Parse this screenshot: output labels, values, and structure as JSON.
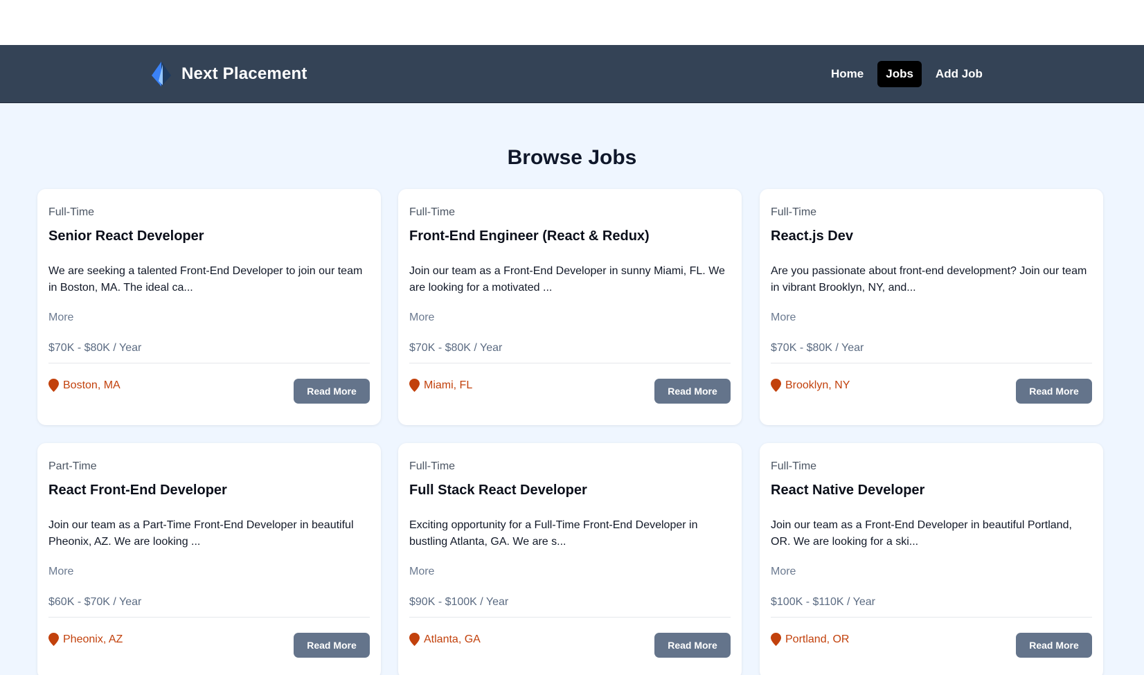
{
  "brand": {
    "name": "Next Placement",
    "logo_icon": "compass-needle-icon"
  },
  "nav": {
    "items": [
      {
        "label": "Home",
        "active": false
      },
      {
        "label": "Jobs",
        "active": true
      },
      {
        "label": "Add Job",
        "active": false
      }
    ]
  },
  "page": {
    "title": "Browse Jobs"
  },
  "colors": {
    "navbar_bg": "#344356",
    "page_bg": "#eff6ff",
    "location_text": "#c2410c",
    "button_bg": "#64748b",
    "active_nav_bg": "#000000"
  },
  "jobs": [
    {
      "type": "Full-Time",
      "title": "Senior React Developer",
      "description": "We are seeking a talented Front-End Developer to join our team in Boston, MA. The ideal ca...",
      "more_label": "More",
      "salary": "$70K - $80K / Year",
      "location": "Boston, MA",
      "button_label": "Read More"
    },
    {
      "type": "Full-Time",
      "title": "Front-End Engineer (React & Redux)",
      "description": "Join our team as a Front-End Developer in sunny Miami, FL. We are looking for a motivated ...",
      "more_label": "More",
      "salary": "$70K - $80K / Year",
      "location": "Miami, FL",
      "button_label": "Read More"
    },
    {
      "type": "Full-Time",
      "title": "React.js Dev",
      "description": "Are you passionate about front-end development? Join our team in vibrant Brooklyn, NY, and...",
      "more_label": "More",
      "salary": "$70K - $80K / Year",
      "location": "Brooklyn, NY",
      "button_label": "Read More"
    },
    {
      "type": "Part-Time",
      "title": "React Front-End Developer",
      "description": "Join our team as a Part-Time Front-End Developer in beautiful Pheonix, AZ. We are looking ...",
      "more_label": "More",
      "salary": "$60K - $70K / Year",
      "location": "Pheonix, AZ",
      "button_label": "Read More"
    },
    {
      "type": "Full-Time",
      "title": "Full Stack React Developer",
      "description": "Exciting opportunity for a Full-Time Front-End Developer in bustling Atlanta, GA. We are s...",
      "more_label": "More",
      "salary": "$90K - $100K / Year",
      "location": "Atlanta, GA",
      "button_label": "Read More"
    },
    {
      "type": "Full-Time",
      "title": "React Native Developer",
      "description": "Join our team as a Front-End Developer in beautiful Portland, OR. We are looking for a ski...",
      "more_label": "More",
      "salary": "$100K - $110K / Year",
      "location": "Portland, OR",
      "button_label": "Read More"
    }
  ]
}
